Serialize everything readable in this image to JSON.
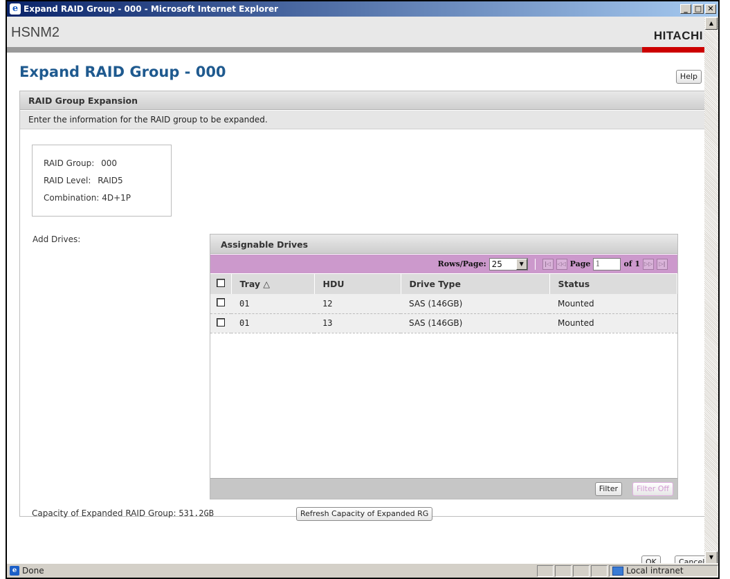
{
  "window": {
    "title": "Expand RAID Group - 000 - Microsoft Internet Explorer",
    "min": "_",
    "max": "□",
    "close": "✕"
  },
  "header": {
    "brand": "HSNM2",
    "logo": "HITACHI",
    "accent_color": "#cc0000"
  },
  "page": {
    "title": "Expand RAID Group - 000",
    "help_label": "Help"
  },
  "section": {
    "header": "RAID Group Expansion",
    "description": "Enter the information for the RAID group to be expanded."
  },
  "info": {
    "raid_group_label": "RAID Group:",
    "raid_group_value": "000",
    "raid_level_label": "RAID Level:",
    "raid_level_value": "RAID5",
    "combination_label": "Combination:",
    "combination_value": "4D+1P"
  },
  "add_drives_label": "Add Drives:",
  "drives": {
    "header": "Assignable Drives",
    "rows_per_page_label": "Rows/Page:",
    "rows_per_page_value": "25",
    "page_label": "Page",
    "page_value": "1",
    "of_label": "of 1",
    "nav_first": "|◁",
    "nav_prev": "◁◁",
    "nav_next": "▷▷",
    "nav_last": "▷|",
    "columns": [
      "Tray △",
      "HDU",
      "Drive Type",
      "Status"
    ],
    "rows": [
      {
        "tray": "01",
        "hdu": "12",
        "drive_type": "SAS (146GB)",
        "status": "Mounted"
      },
      {
        "tray": "01",
        "hdu": "13",
        "drive_type": "SAS (146GB)",
        "status": "Mounted"
      }
    ],
    "filter_label": "Filter",
    "filter_off_label": "Filter Off",
    "pager_color": "#cc99cc"
  },
  "capacity": {
    "label": "Capacity of Expanded RAID Group:",
    "value": "531.2GB",
    "refresh_label": "Refresh Capacity of Expanded RG"
  },
  "actions": {
    "ok_label": "OK",
    "cancel_label": "Cancel"
  },
  "statusbar": {
    "status": "Done",
    "zone": "Local intranet"
  }
}
